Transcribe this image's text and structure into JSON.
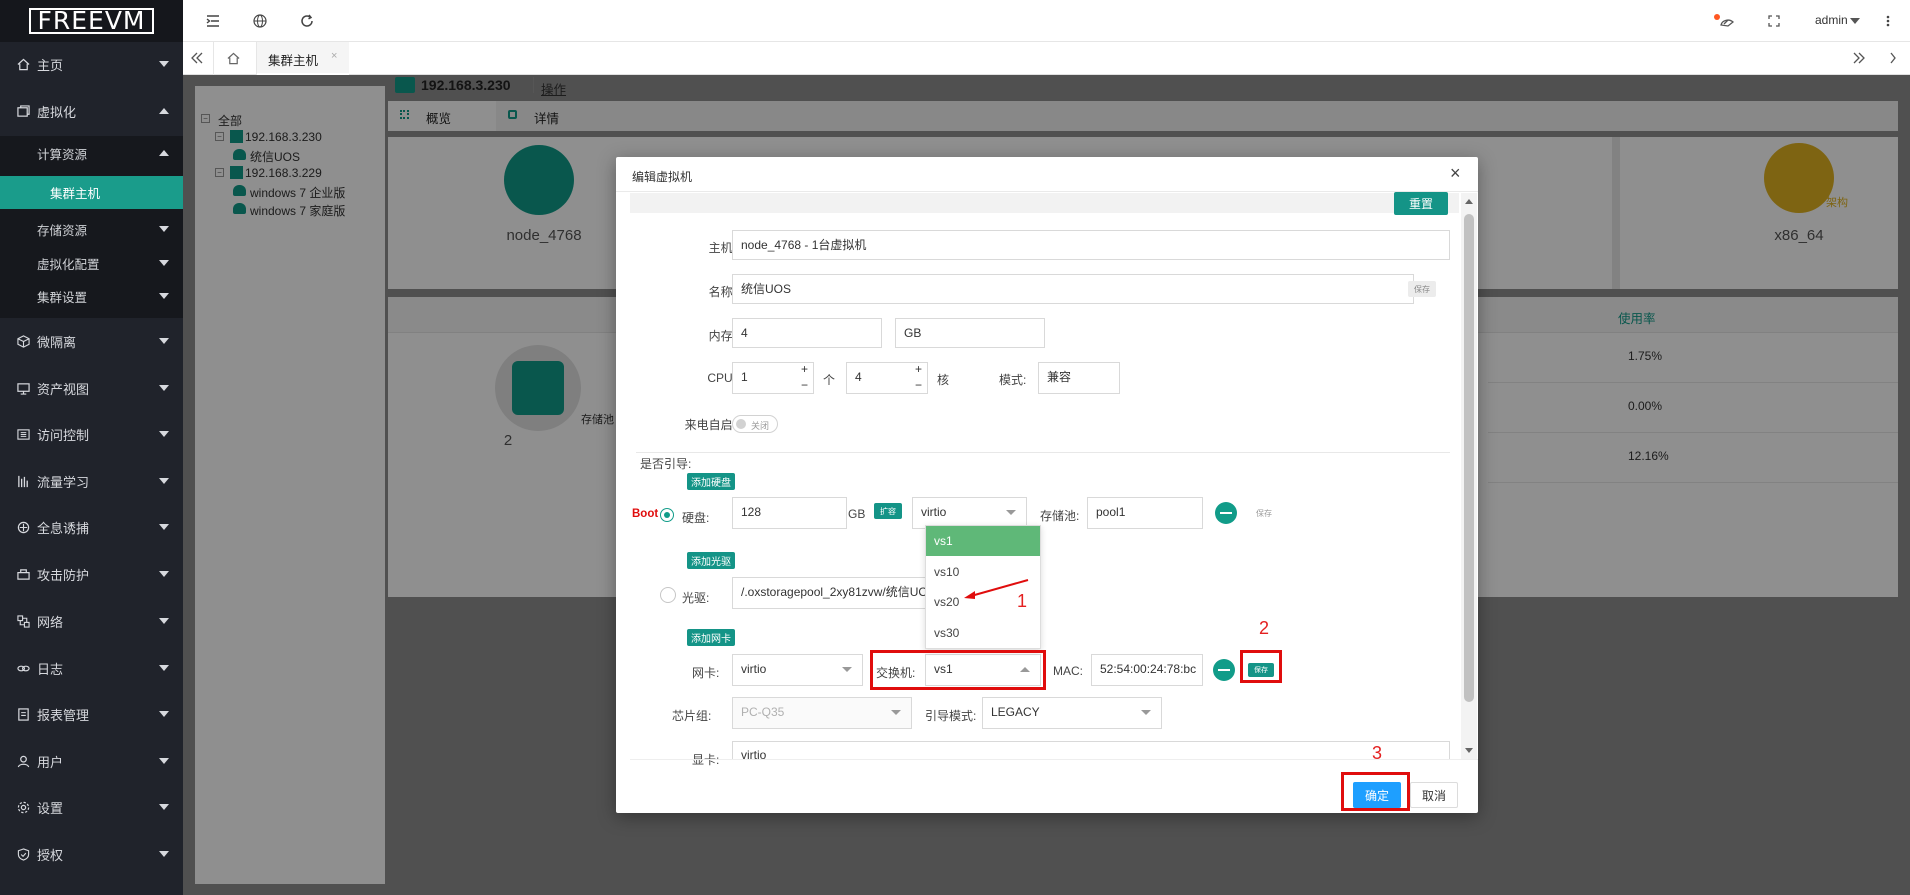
{
  "sidebar": {
    "logo": "FREEVM",
    "items": [
      {
        "label": "主页"
      },
      {
        "label": "虚拟化"
      },
      {
        "label": "微隔离"
      },
      {
        "label": "资产视图"
      },
      {
        "label": "访问控制"
      },
      {
        "label": "流量学习"
      },
      {
        "label": "全息诱捕"
      },
      {
        "label": "攻击防护"
      },
      {
        "label": "网络"
      },
      {
        "label": "日志"
      },
      {
        "label": "报表管理"
      },
      {
        "label": "用户"
      },
      {
        "label": "设置"
      },
      {
        "label": "授权"
      }
    ],
    "sub": [
      {
        "label": "计算资源"
      },
      {
        "label": "集群主机"
      },
      {
        "label": "存储资源"
      },
      {
        "label": "虚拟化配置"
      },
      {
        "label": "集群设置"
      }
    ]
  },
  "topbar": {
    "user": "admin"
  },
  "tabs": {
    "active": "集群主机"
  },
  "tree": {
    "root": "全部",
    "host1": "192.168.3.230",
    "vm1": "统信UOS",
    "host2": "192.168.3.229",
    "vm2": "windows 7 企业版",
    "vm3": "windows 7 家庭版"
  },
  "hostpanel": {
    "ip": "192.168.3.230",
    "action": "操作",
    "tab_overview": "概览",
    "tab_detail": "详情",
    "card1_value": "node_4768",
    "card2_label": "架构",
    "card2_value": "x86_64",
    "storage_label": "存储池",
    "storage_count": "2",
    "usage_header": "使用率",
    "usage": [
      "1.75%",
      "0.00%",
      "12.16%"
    ]
  },
  "modal": {
    "title": "编辑虚拟机",
    "reset": "重置",
    "host_label": "主机:",
    "host_value": "node_4768 - 1台虚拟机",
    "name_label": "名称:",
    "name_value": "统信UOS",
    "save": "保存",
    "mem_label": "内存:",
    "mem_value": "4",
    "mem_unit": "GB",
    "cpu_label": "CPU:",
    "cpu_value": "1",
    "cpu_unit1": "个",
    "cores_value": "4",
    "cpu_unit2": "核",
    "mode_label": "模式:",
    "mode_value": "兼容",
    "autostart_label": "来电自启:",
    "autostart_state": "关闭",
    "boot_section": "是否引导:",
    "add_disk": "添加硬盘",
    "boot_marker": "Boot",
    "disk_label": "硬盘:",
    "disk_size": "128",
    "disk_unit": "GB",
    "expand": "扩容",
    "disk_bus": "virtio",
    "pool_label": "存储池:",
    "pool_value": "pool1",
    "add_cdrom": "添加光驱",
    "cdrom_label": "光驱:",
    "cdrom_value": "/.oxstoragepool_2xy81zvw/统信UOS",
    "add_nic": "添加网卡",
    "nic_label": "网卡:",
    "nic_model": "virtio",
    "switch_label": "交换机:",
    "switch_value": "vs1",
    "switch_options": [
      "vs1",
      "vs10",
      "vs20",
      "vs30"
    ],
    "mac_label": "MAC:",
    "mac_value": "52:54:00:24:78:bc",
    "chipset_label": "芯片组:",
    "chipset_value": "PC-Q35",
    "bootmode_label": "引导模式:",
    "bootmode_value": "LEGACY",
    "display_label": "显卡:",
    "display_value": "virtio",
    "ok": "确定",
    "cancel": "取消"
  },
  "annotations": [
    "1",
    "2",
    "3"
  ],
  "colors": {
    "accent": "#149487",
    "sidebar": "#20232b",
    "primary": "#1e9fff",
    "annotation": "#e00d0d"
  }
}
